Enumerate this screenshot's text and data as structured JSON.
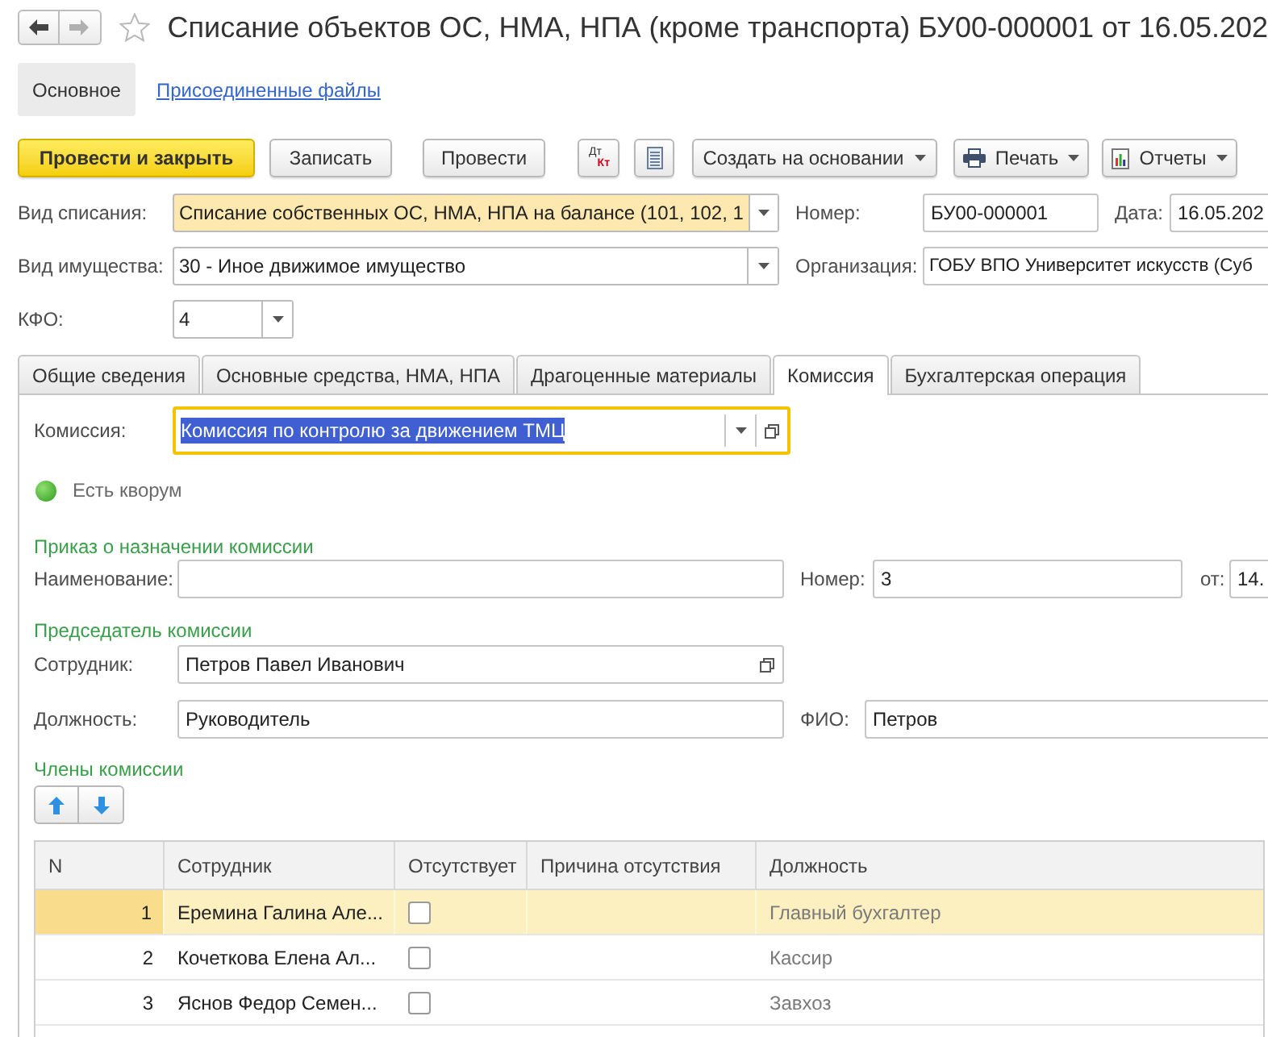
{
  "window": {
    "title": "Списание объектов ОС, НМА, НПА (кроме транспорта) БУ00-000001 от 16.05.202",
    "favorite": false
  },
  "navigation": {
    "back": {
      "disabled": false
    },
    "forward": {
      "disabled": true
    }
  },
  "form_tabs": [
    {
      "label": "Основное",
      "selected": true
    },
    {
      "label": "Присоединенные файлы",
      "selected": false
    }
  ],
  "toolbar": [
    {
      "kind": "primary",
      "label": "Провести и закрыть"
    },
    {
      "kind": "button",
      "label": "Записать"
    },
    {
      "kind": "button",
      "label": "Провести"
    },
    {
      "kind": "dtkt",
      "label_top": "Дт",
      "label_bottom": "Кт"
    },
    {
      "kind": "sheet"
    },
    {
      "kind": "menu",
      "label": "Создать на основании"
    },
    {
      "kind": "print",
      "label": "Печать"
    },
    {
      "kind": "report",
      "label": "Отчеты"
    }
  ],
  "header": {
    "write_off_type": {
      "label": "Вид списания:",
      "value": "Списание собственных ОС, НМА, НПА на балансе (101, 102, 1",
      "highlighted": true
    },
    "number": {
      "label": "Номер:",
      "value": "БУ00-000001"
    },
    "date": {
      "label": "Дата:",
      "value": "16.05.202"
    },
    "property_type": {
      "label": "Вид имущества:",
      "value": "30 - Иное движимое имущество",
      "highlighted": false
    },
    "organization": {
      "label": "Организация:",
      "value": "ГОБУ ВПО Университет искусств (Суб"
    },
    "kfo": {
      "label": "КФО:",
      "value": "4",
      "highlighted": false
    }
  },
  "doc_tabs": [
    {
      "label": "Общие сведения",
      "selected": false
    },
    {
      "label": "Основные средства, НМА, НПА",
      "selected": false
    },
    {
      "label": "Драгоценные материалы",
      "selected": false
    },
    {
      "label": "Комиссия",
      "selected": true
    },
    {
      "label": "Бухгалтерская операция",
      "selected": false
    }
  ],
  "commission": {
    "label": "Комиссия:",
    "value": "Комиссия по контролю за движением ТМЦ",
    "focused": true,
    "quorum": {
      "label": "Есть кворум",
      "met": true
    }
  },
  "order": {
    "heading": "Приказ о назначении комиссии",
    "name": {
      "label": "Наименование:"
    },
    "number": {
      "label": "Номер:",
      "value": "3"
    },
    "date": {
      "label": "от:",
      "value": "14."
    }
  },
  "chairman": {
    "heading": "Председатель комиссии",
    "employee": {
      "label": "Сотрудник:",
      "value": "Петров Павел Иванович"
    },
    "position": {
      "label": "Должность:",
      "value": "Руководитель"
    },
    "full_name": {
      "label": "ФИО:",
      "value": "Петров"
    }
  },
  "members": {
    "heading": "Члены комиссии",
    "columns": [
      "N",
      "Сотрудник",
      "Отсутствует",
      "Причина отсутствия",
      "Должность"
    ],
    "rows": [
      {
        "n": "1",
        "employee": "Еремина Галина Але...",
        "absent": false,
        "position": "Главный бухгалтер",
        "selected": true
      },
      {
        "n": "2",
        "employee": "Кочеткова Елена Ал...",
        "absent": false,
        "position": "Кассир",
        "selected": false
      },
      {
        "n": "3",
        "employee": "Яснов Федор Семен...",
        "absent": false,
        "position": "Завхоз",
        "selected": false
      }
    ]
  }
}
